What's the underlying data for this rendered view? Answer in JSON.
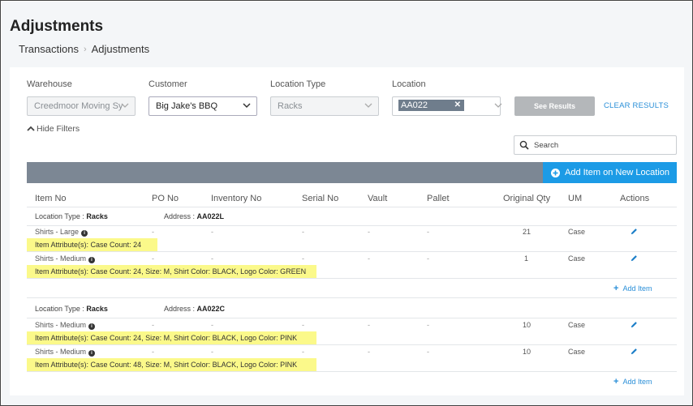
{
  "page": {
    "title": "Adjustments"
  },
  "breadcrumb": {
    "items": [
      "Transactions",
      "Adjustments"
    ]
  },
  "filters": {
    "warehouse": {
      "label": "Warehouse",
      "value": "Creedmoor Moving Sy"
    },
    "customer": {
      "label": "Customer",
      "value": "Big Jake's BBQ"
    },
    "location_type": {
      "label": "Location Type",
      "value": "Racks"
    },
    "location": {
      "label": "Location",
      "tag": "AA022"
    },
    "see_results": "See Results",
    "clear_results": "CLEAR RESULTS",
    "hide_filters": "Hide Filters",
    "search_placeholder": "Search"
  },
  "toolbar": {
    "add_on_new_location": "Add Item on New Location"
  },
  "columns": [
    "Item No",
    "PO No",
    "Inventory No",
    "Serial No",
    "Vault",
    "Pallet",
    "Original Qty",
    "UM",
    "Actions"
  ],
  "groups": [
    {
      "location_type_label": "Location Type :",
      "location_type": "Racks",
      "address_label": "Address :",
      "address": "AA022L",
      "items": [
        {
          "item": "Shirts - Large",
          "po": "-",
          "inv": "-",
          "serial": "-",
          "vault": "-",
          "pallet": "-",
          "qty": "21",
          "um": "Case",
          "attr_label": "Item Attribute(s):",
          "attr": "Case Count: 24"
        },
        {
          "item": "Shirts - Medium",
          "po": "-",
          "inv": "-",
          "serial": "-",
          "vault": "-",
          "pallet": "-",
          "qty": "1",
          "um": "Case",
          "attr_label": "Item Attribute(s):",
          "attr": "Case Count: 24, Size: M, Shirt Color: BLACK, Logo Color: GREEN"
        }
      ],
      "add_item": "Add Item"
    },
    {
      "location_type_label": "Location Type :",
      "location_type": "Racks",
      "address_label": "Address :",
      "address": "AA022C",
      "items": [
        {
          "item": "Shirts - Medium",
          "po": "-",
          "inv": "-",
          "serial": "-",
          "vault": "-",
          "pallet": "-",
          "qty": "10",
          "um": "Case",
          "attr_label": "Item Attribute(s):",
          "attr": "Case Count: 24, Size: M, Shirt Color: BLACK, Logo Color: PINK"
        },
        {
          "item": "Shirts - Medium",
          "po": "-",
          "inv": "-",
          "serial": "-",
          "vault": "-",
          "pallet": "-",
          "qty": "10",
          "um": "Case",
          "attr_label": "Item Attribute(s):",
          "attr": "Case Count: 48, Size: M, Shirt Color: BLACK, Logo Color: PINK"
        }
      ],
      "add_item": "Add Item"
    }
  ],
  "colors": {
    "accent": "#1c9be6",
    "highlight": "#fbf98a",
    "table_bar": "#7c8794"
  }
}
